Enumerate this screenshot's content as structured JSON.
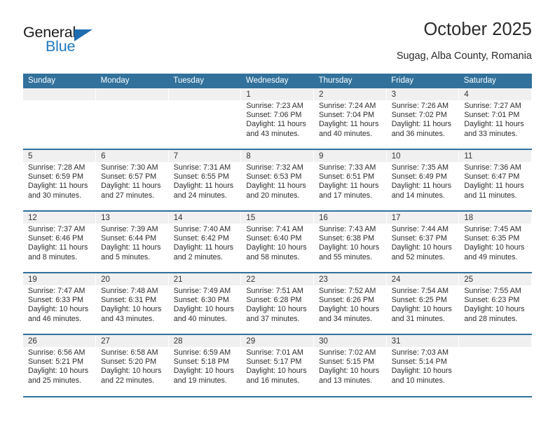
{
  "brand": {
    "name_top": "General",
    "name_bottom": "Blue",
    "triangle_icon": "blue-triangle-logo-mark",
    "accent_color": "#1f78c1"
  },
  "header": {
    "title": "October 2025",
    "subtitle": "Sugag, Alba County, Romania"
  },
  "theme": {
    "header_bg": "#31719b",
    "header_text": "#ffffff",
    "daynum_bg": "#f0f0f0",
    "cell_bg": "#ffffff",
    "body_text": "#2c2c2c"
  },
  "calendar": {
    "weekdays": [
      "Sunday",
      "Monday",
      "Tuesday",
      "Wednesday",
      "Thursday",
      "Friday",
      "Saturday"
    ],
    "labels": {
      "sunrise": "Sunrise:",
      "sunset": "Sunset:",
      "daylight": "Daylight:"
    },
    "weeks": [
      [
        {
          "day": "",
          "sunrise": "",
          "sunset": "",
          "daylight_line1": "",
          "daylight_line2": ""
        },
        {
          "day": "",
          "sunrise": "",
          "sunset": "",
          "daylight_line1": "",
          "daylight_line2": ""
        },
        {
          "day": "",
          "sunrise": "",
          "sunset": "",
          "daylight_line1": "",
          "daylight_line2": ""
        },
        {
          "day": "1",
          "sunrise": "Sunrise: 7:23 AM",
          "sunset": "Sunset: 7:06 PM",
          "daylight_line1": "Daylight: 11 hours",
          "daylight_line2": "and 43 minutes."
        },
        {
          "day": "2",
          "sunrise": "Sunrise: 7:24 AM",
          "sunset": "Sunset: 7:04 PM",
          "daylight_line1": "Daylight: 11 hours",
          "daylight_line2": "and 40 minutes."
        },
        {
          "day": "3",
          "sunrise": "Sunrise: 7:26 AM",
          "sunset": "Sunset: 7:02 PM",
          "daylight_line1": "Daylight: 11 hours",
          "daylight_line2": "and 36 minutes."
        },
        {
          "day": "4",
          "sunrise": "Sunrise: 7:27 AM",
          "sunset": "Sunset: 7:01 PM",
          "daylight_line1": "Daylight: 11 hours",
          "daylight_line2": "and 33 minutes."
        }
      ],
      [
        {
          "day": "5",
          "sunrise": "Sunrise: 7:28 AM",
          "sunset": "Sunset: 6:59 PM",
          "daylight_line1": "Daylight: 11 hours",
          "daylight_line2": "and 30 minutes."
        },
        {
          "day": "6",
          "sunrise": "Sunrise: 7:30 AM",
          "sunset": "Sunset: 6:57 PM",
          "daylight_line1": "Daylight: 11 hours",
          "daylight_line2": "and 27 minutes."
        },
        {
          "day": "7",
          "sunrise": "Sunrise: 7:31 AM",
          "sunset": "Sunset: 6:55 PM",
          "daylight_line1": "Daylight: 11 hours",
          "daylight_line2": "and 24 minutes."
        },
        {
          "day": "8",
          "sunrise": "Sunrise: 7:32 AM",
          "sunset": "Sunset: 6:53 PM",
          "daylight_line1": "Daylight: 11 hours",
          "daylight_line2": "and 20 minutes."
        },
        {
          "day": "9",
          "sunrise": "Sunrise: 7:33 AM",
          "sunset": "Sunset: 6:51 PM",
          "daylight_line1": "Daylight: 11 hours",
          "daylight_line2": "and 17 minutes."
        },
        {
          "day": "10",
          "sunrise": "Sunrise: 7:35 AM",
          "sunset": "Sunset: 6:49 PM",
          "daylight_line1": "Daylight: 11 hours",
          "daylight_line2": "and 14 minutes."
        },
        {
          "day": "11",
          "sunrise": "Sunrise: 7:36 AM",
          "sunset": "Sunset: 6:47 PM",
          "daylight_line1": "Daylight: 11 hours",
          "daylight_line2": "and 11 minutes."
        }
      ],
      [
        {
          "day": "12",
          "sunrise": "Sunrise: 7:37 AM",
          "sunset": "Sunset: 6:46 PM",
          "daylight_line1": "Daylight: 11 hours",
          "daylight_line2": "and 8 minutes."
        },
        {
          "day": "13",
          "sunrise": "Sunrise: 7:39 AM",
          "sunset": "Sunset: 6:44 PM",
          "daylight_line1": "Daylight: 11 hours",
          "daylight_line2": "and 5 minutes."
        },
        {
          "day": "14",
          "sunrise": "Sunrise: 7:40 AM",
          "sunset": "Sunset: 6:42 PM",
          "daylight_line1": "Daylight: 11 hours",
          "daylight_line2": "and 2 minutes."
        },
        {
          "day": "15",
          "sunrise": "Sunrise: 7:41 AM",
          "sunset": "Sunset: 6:40 PM",
          "daylight_line1": "Daylight: 10 hours",
          "daylight_line2": "and 58 minutes."
        },
        {
          "day": "16",
          "sunrise": "Sunrise: 7:43 AM",
          "sunset": "Sunset: 6:38 PM",
          "daylight_line1": "Daylight: 10 hours",
          "daylight_line2": "and 55 minutes."
        },
        {
          "day": "17",
          "sunrise": "Sunrise: 7:44 AM",
          "sunset": "Sunset: 6:37 PM",
          "daylight_line1": "Daylight: 10 hours",
          "daylight_line2": "and 52 minutes."
        },
        {
          "day": "18",
          "sunrise": "Sunrise: 7:45 AM",
          "sunset": "Sunset: 6:35 PM",
          "daylight_line1": "Daylight: 10 hours",
          "daylight_line2": "and 49 minutes."
        }
      ],
      [
        {
          "day": "19",
          "sunrise": "Sunrise: 7:47 AM",
          "sunset": "Sunset: 6:33 PM",
          "daylight_line1": "Daylight: 10 hours",
          "daylight_line2": "and 46 minutes."
        },
        {
          "day": "20",
          "sunrise": "Sunrise: 7:48 AM",
          "sunset": "Sunset: 6:31 PM",
          "daylight_line1": "Daylight: 10 hours",
          "daylight_line2": "and 43 minutes."
        },
        {
          "day": "21",
          "sunrise": "Sunrise: 7:49 AM",
          "sunset": "Sunset: 6:30 PM",
          "daylight_line1": "Daylight: 10 hours",
          "daylight_line2": "and 40 minutes."
        },
        {
          "day": "22",
          "sunrise": "Sunrise: 7:51 AM",
          "sunset": "Sunset: 6:28 PM",
          "daylight_line1": "Daylight: 10 hours",
          "daylight_line2": "and 37 minutes."
        },
        {
          "day": "23",
          "sunrise": "Sunrise: 7:52 AM",
          "sunset": "Sunset: 6:26 PM",
          "daylight_line1": "Daylight: 10 hours",
          "daylight_line2": "and 34 minutes."
        },
        {
          "day": "24",
          "sunrise": "Sunrise: 7:54 AM",
          "sunset": "Sunset: 6:25 PM",
          "daylight_line1": "Daylight: 10 hours",
          "daylight_line2": "and 31 minutes."
        },
        {
          "day": "25",
          "sunrise": "Sunrise: 7:55 AM",
          "sunset": "Sunset: 6:23 PM",
          "daylight_line1": "Daylight: 10 hours",
          "daylight_line2": "and 28 minutes."
        }
      ],
      [
        {
          "day": "26",
          "sunrise": "Sunrise: 6:56 AM",
          "sunset": "Sunset: 5:21 PM",
          "daylight_line1": "Daylight: 10 hours",
          "daylight_line2": "and 25 minutes."
        },
        {
          "day": "27",
          "sunrise": "Sunrise: 6:58 AM",
          "sunset": "Sunset: 5:20 PM",
          "daylight_line1": "Daylight: 10 hours",
          "daylight_line2": "and 22 minutes."
        },
        {
          "day": "28",
          "sunrise": "Sunrise: 6:59 AM",
          "sunset": "Sunset: 5:18 PM",
          "daylight_line1": "Daylight: 10 hours",
          "daylight_line2": "and 19 minutes."
        },
        {
          "day": "29",
          "sunrise": "Sunrise: 7:01 AM",
          "sunset": "Sunset: 5:17 PM",
          "daylight_line1": "Daylight: 10 hours",
          "daylight_line2": "and 16 minutes."
        },
        {
          "day": "30",
          "sunrise": "Sunrise: 7:02 AM",
          "sunset": "Sunset: 5:15 PM",
          "daylight_line1": "Daylight: 10 hours",
          "daylight_line2": "and 13 minutes."
        },
        {
          "day": "31",
          "sunrise": "Sunrise: 7:03 AM",
          "sunset": "Sunset: 5:14 PM",
          "daylight_line1": "Daylight: 10 hours",
          "daylight_line2": "and 10 minutes."
        },
        {
          "day": "",
          "sunrise": "",
          "sunset": "",
          "daylight_line1": "",
          "daylight_line2": ""
        }
      ]
    ]
  }
}
